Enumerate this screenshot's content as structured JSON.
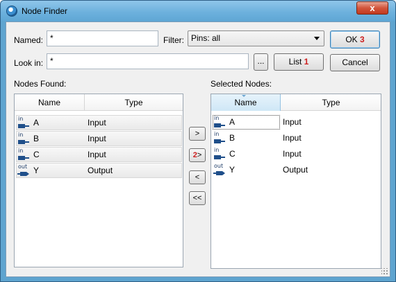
{
  "window": {
    "title": "Node Finder",
    "close_label": "x"
  },
  "named": {
    "label": "Named:",
    "value": "*"
  },
  "filter": {
    "label": "Filter:",
    "selected": "Pins: all"
  },
  "look_in": {
    "label": "Look in:",
    "value": "*",
    "browse_label": "..."
  },
  "buttons": {
    "ok": "OK",
    "ok_badge": "3",
    "list": "List",
    "list_badge": "1",
    "cancel": "Cancel"
  },
  "nodes_found": {
    "title": "Nodes Found:",
    "columns": [
      "Name",
      "Type"
    ],
    "rows": [
      {
        "pin": "in",
        "name": "A",
        "type": "Input"
      },
      {
        "pin": "in",
        "name": "B",
        "type": "Input"
      },
      {
        "pin": "in",
        "name": "C",
        "type": "Input"
      },
      {
        "pin": "out",
        "name": "Y",
        "type": "Output"
      }
    ]
  },
  "selected_nodes": {
    "title": "Selected Nodes:",
    "columns": [
      "Name",
      "Type"
    ],
    "rows": [
      {
        "pin": "in",
        "name": "A",
        "type": "Input"
      },
      {
        "pin": "in",
        "name": "B",
        "type": "Input"
      },
      {
        "pin": "in",
        "name": "C",
        "type": "Input"
      },
      {
        "pin": "out",
        "name": "Y",
        "type": "Output"
      }
    ]
  },
  "transfer": {
    "copy_selected": ">",
    "copy_all_badge": "2",
    "copy_all": ">",
    "remove_selected": "<",
    "remove_all": "<<"
  },
  "icons": {
    "app": "node-finder-app-icon",
    "input_pin": "input-pin-icon",
    "output_pin": "output-pin-icon"
  },
  "colors": {
    "title_bar": "#6db1dd",
    "badge": "#cc1f1f",
    "pin": "#1f4f8a"
  }
}
